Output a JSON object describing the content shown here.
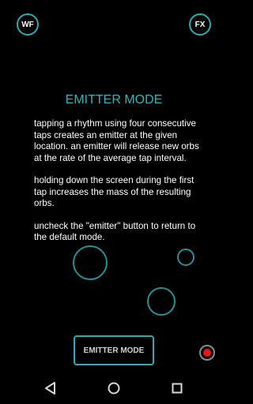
{
  "top_buttons": {
    "wf": "WF",
    "fx": "FX"
  },
  "title": "EMITTER MODE",
  "paragraphs": [
    "tapping a rhythm using four consecutive taps creates an emitter at the given location. an emitter will release new orbs at the rate of the average tap interval.",
    "holding down the screen during the first tap increases the mass of the resulting orbs.",
    "uncheck the \"emitter\" button to return to the default mode."
  ],
  "emitter_button": "EMITTER MODE",
  "record_icon": "record-dot-icon",
  "nav": {
    "back_icon": "back-triangle-icon",
    "home_icon": "home-circle-icon",
    "recents_icon": "recents-square-icon"
  },
  "colors": {
    "accent": "#35b3bd",
    "orb": "#2a8f97",
    "record": "#e8151b",
    "background": "#000000"
  }
}
